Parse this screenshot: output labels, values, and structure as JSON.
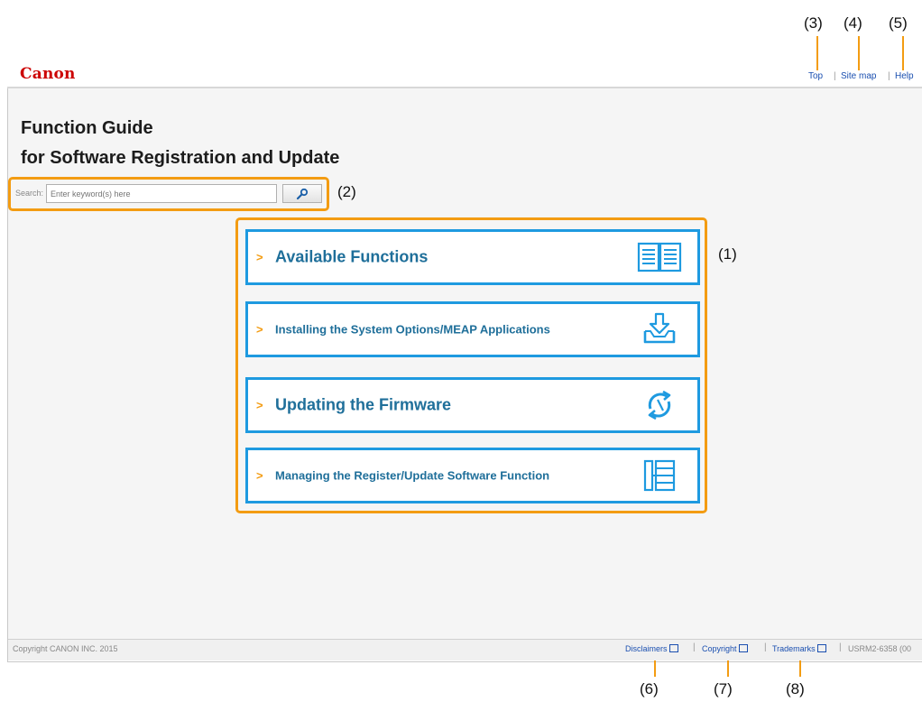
{
  "header": {
    "logo": "Canon",
    "links": [
      {
        "label": "Top"
      },
      {
        "label": "Site map"
      },
      {
        "label": "Help"
      }
    ]
  },
  "page": {
    "title_line1": "Function Guide",
    "title_line2": "for Software Registration and Update"
  },
  "search": {
    "label": "Search:",
    "placeholder": "Enter keyword(s) here",
    "button_icon": "magnifier-icon"
  },
  "cards": [
    {
      "label": "Available Functions",
      "icon": "open-book-icon"
    },
    {
      "label": "Installing the System Options/MEAP Applications",
      "icon": "download-tray-icon"
    },
    {
      "label": "Updating the Firmware",
      "icon": "refresh-arrows-icon"
    },
    {
      "label": "Managing the Register/Update Software Function",
      "icon": "list-panel-icon"
    }
  ],
  "footer": {
    "copyright": "Copyright CANON INC. 2015",
    "links": [
      {
        "label": "Disclaimers"
      },
      {
        "label": "Copyright"
      },
      {
        "label": "Trademarks"
      }
    ],
    "doc_id": "USRM2-6358 (00"
  },
  "callouts": {
    "m1": "(1)",
    "m2": "(2)",
    "m3": "(3)",
    "m4": "(4)",
    "m5": "(5)",
    "m6": "(6)",
    "m7": "(7)",
    "m8": "(8)"
  },
  "colors": {
    "accent_orange": "#f39c12",
    "card_border": "#1e9ae0",
    "card_text": "#1f6f9a",
    "logo_red": "#cc0000",
    "link_blue": "#1a4fb0"
  }
}
